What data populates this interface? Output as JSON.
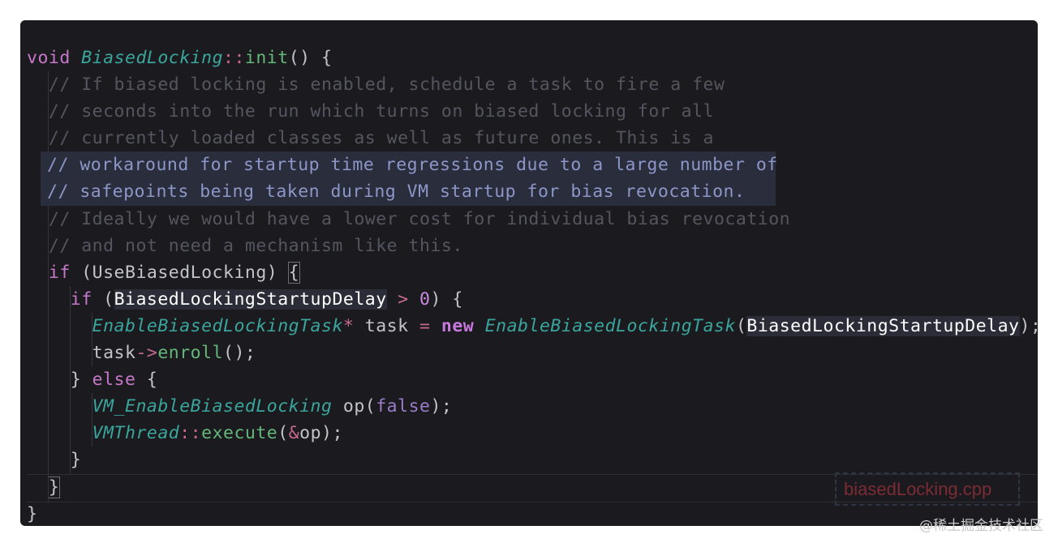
{
  "file_name": "biasedLocking.cpp",
  "watermark": "@稀土掘金技术社区",
  "code": {
    "l1": {
      "kw": "void",
      "cls": "BiasedLocking",
      "sep": "::",
      "fn": "init",
      "rest": "() {"
    },
    "l2": "// If biased locking is enabled, schedule a task to fire a few",
    "l3": "// seconds into the run which turns on biased locking for all",
    "l4": "// currently loaded classes as well as future ones. This is a",
    "l5": "// workaround for startup time regressions due to a large number of",
    "l6": "// safepoints being taken during VM startup for bias revocation.",
    "l7": "// Ideally we would have a lower cost for individual bias revocation",
    "l8": "// and not need a mechanism like this.",
    "l9": {
      "kw": "if",
      "open": " (",
      "cond": "UseBiasedLocking",
      "close": ") ",
      "brace": "{"
    },
    "l10": {
      "kw": "if",
      "open": " (",
      "cond": "BiasedLockingStartupDelay",
      "gt": " > ",
      "num": "0",
      "close": ") {"
    },
    "l11": {
      "type": "EnableBiasedLockingTask",
      "ptr": "*",
      "var": " task ",
      "eq": "=",
      "sp": " ",
      "new": "new",
      "sp2": " ",
      "ctor": "EnableBiasedLockingTask",
      "paren": "(",
      "arg": "BiasedLockingStartupDelay",
      "end": ");"
    },
    "l12": {
      "var": "task",
      "arrow": "->",
      "fn": "enroll",
      "end": "();"
    },
    "l13": {
      "open": "} ",
      "kw": "else",
      "end": " {"
    },
    "l14": {
      "type": "VM_EnableBiasedLocking",
      "var": " op(",
      "bool": "false",
      "end": ");"
    },
    "l15": {
      "type": "VMThread",
      "sep": "::",
      "fn": "execute",
      "paren": "(",
      "amp": "&",
      "end": "op);"
    },
    "l16": "}",
    "l17": "}",
    "l18": "}"
  }
}
